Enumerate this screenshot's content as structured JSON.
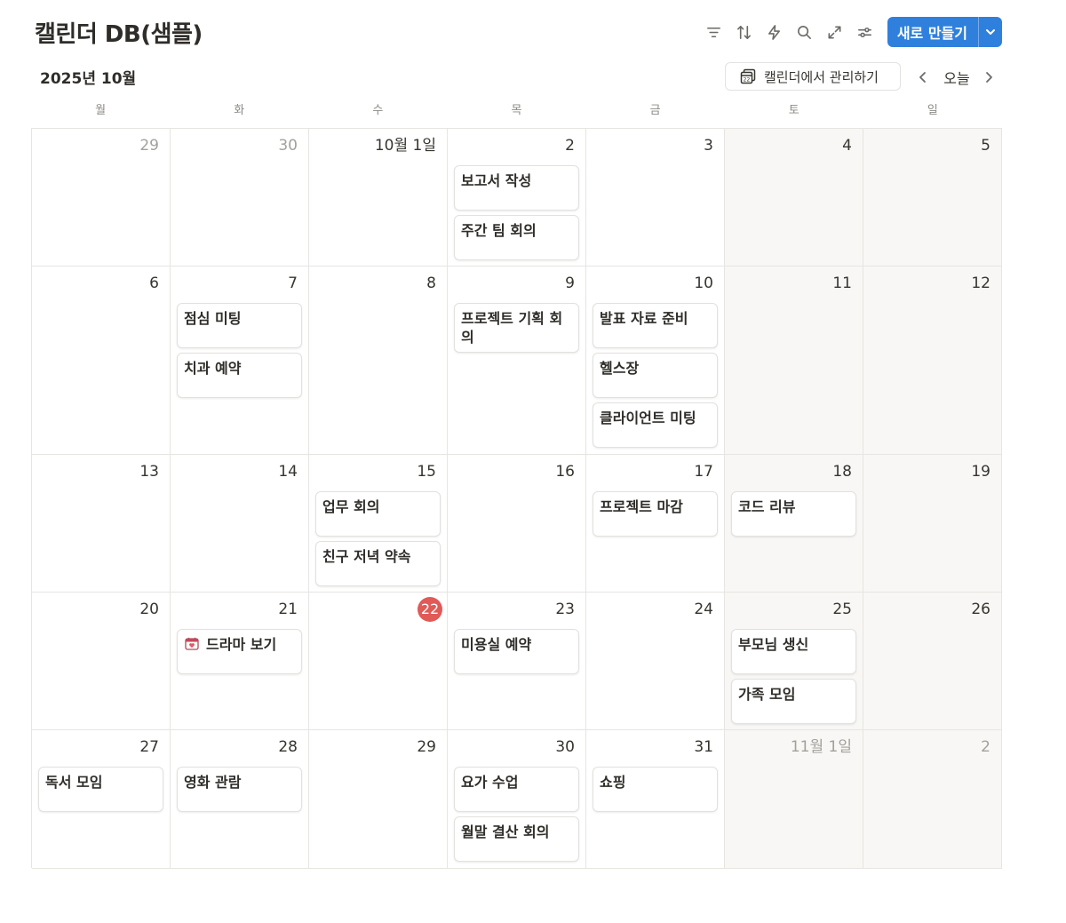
{
  "header": {
    "title": "캘린더 DB(샘플)",
    "new_label": "새로 만들기",
    "toolbar_icons": [
      "filter-icon",
      "sort-icon",
      "automation-icon",
      "search-icon",
      "expand-icon",
      "settings-sliders-icon"
    ]
  },
  "calendar_nav": {
    "month_label": "2025년 10월",
    "manage_label": "캘린더에서 관리하기",
    "today_label": "오늘"
  },
  "weekdays": [
    "월",
    "화",
    "수",
    "목",
    "금",
    "토",
    "일"
  ],
  "colors": {
    "accent": "#2f80dd",
    "today": "#e05a57",
    "weekend_bg": "#f8f7f5"
  },
  "days": [
    {
      "label": "29",
      "muted": true,
      "events": []
    },
    {
      "label": "30",
      "muted": true,
      "events": []
    },
    {
      "label": "10월 1일",
      "events": []
    },
    {
      "label": "2",
      "events": [
        "보고서 작성",
        "주간 팀 회의"
      ]
    },
    {
      "label": "3",
      "events": []
    },
    {
      "label": "4",
      "events": []
    },
    {
      "label": "5",
      "events": []
    },
    {
      "label": "6",
      "events": []
    },
    {
      "label": "7",
      "events": [
        "점심 미팅",
        "치과 예약"
      ]
    },
    {
      "label": "8",
      "events": []
    },
    {
      "label": "9",
      "events": [
        "프로젝트 기획 회의"
      ]
    },
    {
      "label": "10",
      "events": [
        "발표 자료 준비",
        "헬스장",
        "클라이언트 미팅"
      ]
    },
    {
      "label": "11",
      "events": []
    },
    {
      "label": "12",
      "events": []
    },
    {
      "label": "13",
      "events": []
    },
    {
      "label": "14",
      "events": []
    },
    {
      "label": "15",
      "events": [
        "업무 회의",
        "친구 저녁 약속"
      ]
    },
    {
      "label": "16",
      "events": []
    },
    {
      "label": "17",
      "events": [
        "프로젝트 마감"
      ]
    },
    {
      "label": "18",
      "events": [
        "코드 리뷰"
      ]
    },
    {
      "label": "19",
      "events": []
    },
    {
      "label": "20",
      "events": []
    },
    {
      "label": "21",
      "events": [
        "드라마 보기"
      ],
      "event_icon": "calendar-heart-icon"
    },
    {
      "label": "22",
      "today": true,
      "events": []
    },
    {
      "label": "23",
      "events": [
        "미용실 예약"
      ]
    },
    {
      "label": "24",
      "events": []
    },
    {
      "label": "25",
      "events": [
        "부모님 생신",
        "가족 모임"
      ]
    },
    {
      "label": "26",
      "events": []
    },
    {
      "label": "27",
      "events": [
        "독서 모임"
      ]
    },
    {
      "label": "28",
      "events": [
        "영화 관람"
      ]
    },
    {
      "label": "29",
      "events": []
    },
    {
      "label": "30",
      "events": [
        "요가 수업",
        "월말 결산 회의"
      ]
    },
    {
      "label": "31",
      "events": [
        "쇼핑"
      ]
    },
    {
      "label": "11월 1일",
      "muted": true,
      "events": []
    },
    {
      "label": "2",
      "muted": true,
      "events": []
    }
  ]
}
